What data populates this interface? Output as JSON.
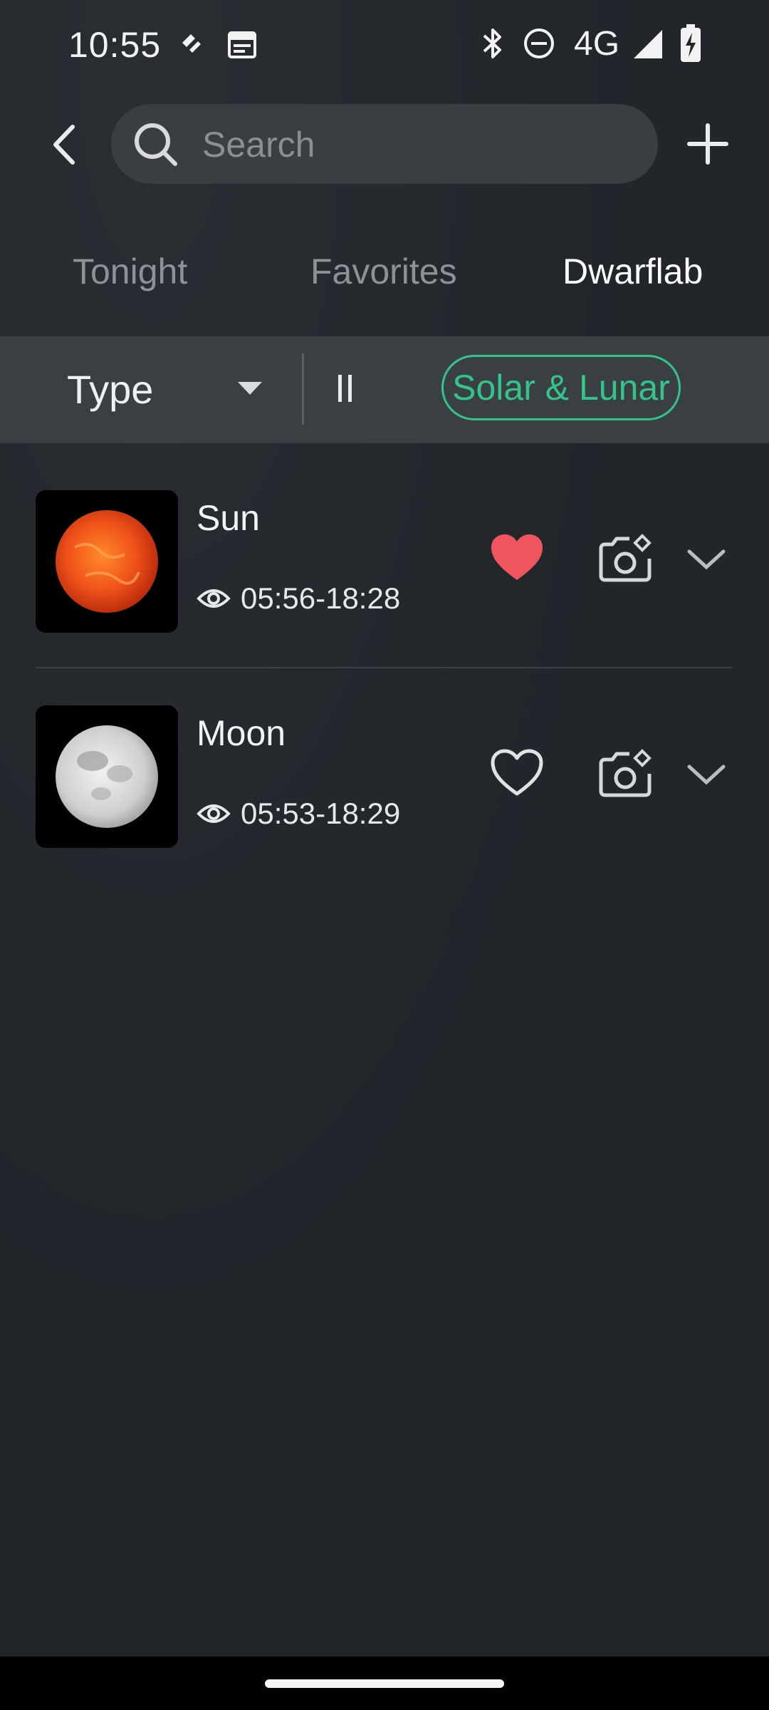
{
  "status_bar": {
    "time": "10:55",
    "network": "4G",
    "icons": [
      "nfc-icon",
      "calendar-icon",
      "bluetooth-icon",
      "dnd-icon",
      "signal-icon",
      "battery-charging-icon"
    ]
  },
  "header": {
    "search_placeholder": "Search",
    "back_icon": "chevron-left-icon",
    "add_icon": "plus-icon"
  },
  "tabs": [
    {
      "label": "Tonight",
      "active": false
    },
    {
      "label": "Favorites",
      "active": false
    },
    {
      "label": "Dwarflab",
      "active": true
    }
  ],
  "filter": {
    "type_label": "Type",
    "chip_label": "Solar & Lunar",
    "accent_color": "#34c48b"
  },
  "objects": [
    {
      "name": "Sun",
      "visibility": "05:56-18:28",
      "favorite": true
    },
    {
      "name": "Moon",
      "visibility": "05:53-18:29",
      "favorite": false
    }
  ],
  "colors": {
    "favorite_active": "#f0555d",
    "background": "#22262b"
  }
}
